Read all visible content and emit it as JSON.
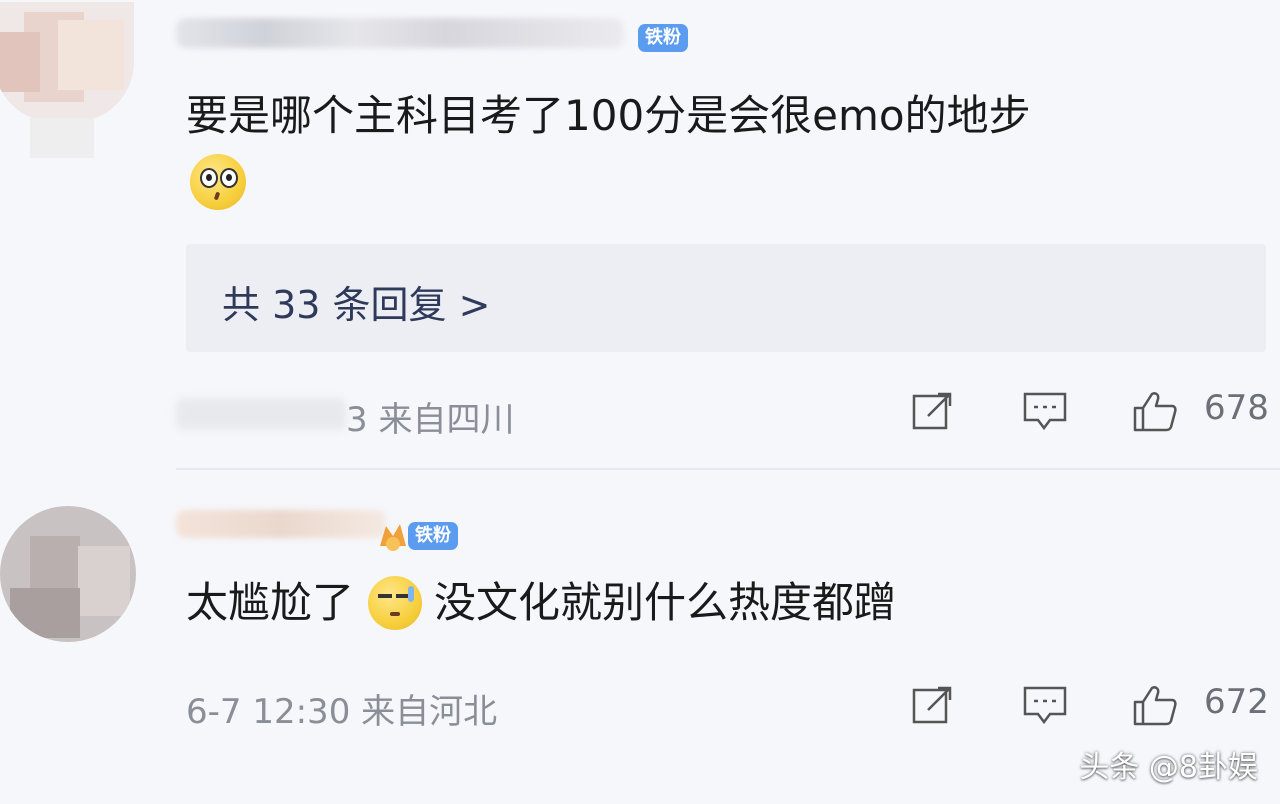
{
  "comments": [
    {
      "username": "",
      "badge": "铁粉",
      "text": "要是哪个主科目考了100分是会很emo的地步",
      "emoji": "surprised-emoji",
      "replies_label": "共 33 条回复 >",
      "meta": "3  来自四川",
      "like_count": "678"
    },
    {
      "username": "",
      "badge": "铁粉",
      "text_before": "太尴尬了",
      "emoji": "awkward-emoji",
      "text_after": "没文化就别什么热度都蹭",
      "meta": "6-7 12:30  来自河北",
      "like_count": "672"
    }
  ],
  "watermark": "头条 @8卦娱",
  "colors": {
    "badge": "#5b9cf0",
    "background": "#f6f7fb",
    "meta": "#8a8e98"
  }
}
